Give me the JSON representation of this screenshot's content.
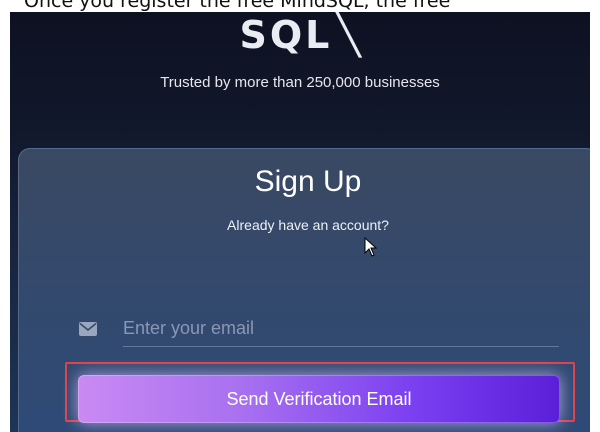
{
  "top_caption": "Once you register the free MindSQL, the free",
  "logo": {
    "text": "SQL",
    "slash": "╲"
  },
  "tagline": "Trusted by more than 250,000 businesses",
  "signup": {
    "title": "Sign Up",
    "subtitle": "Already have an account?",
    "email": {
      "placeholder": "Enter your email",
      "value": ""
    },
    "send_button_label": "Send Verification Email"
  },
  "colors": {
    "page_bg": "#11172a",
    "card_bg": "#34496b",
    "button_start": "#c98af2",
    "button_end": "#5a1fd8",
    "highlight": "#e0424a"
  },
  "icons": {
    "mail": "mail-icon",
    "cursor": "mouse-pointer-icon"
  }
}
